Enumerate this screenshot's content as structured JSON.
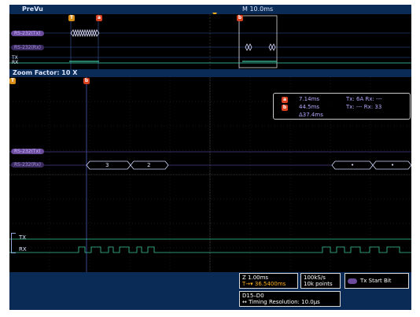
{
  "header": {
    "title": "PreVu",
    "time_label": "M 10.0ms"
  },
  "preview": {
    "channels": [
      {
        "label": "RS-232(Tx)"
      },
      {
        "label": "RS-232(Rx)"
      },
      {
        "label": "RX"
      }
    ],
    "digital_labels": [
      "TX",
      "RX"
    ],
    "marker_t": "T",
    "marker_a": "a",
    "marker_b": "b"
  },
  "zoom": {
    "label": "Zoom Factor: 10 X"
  },
  "main": {
    "marker_t": "T",
    "marker_b": "b",
    "channels": [
      {
        "label": "RS-232(Tx)"
      },
      {
        "label": "RS-232(Rx)"
      }
    ],
    "packets": [
      {
        "text": "3"
      },
      {
        "text": "2"
      },
      {
        "text": "•"
      },
      {
        "text": "•"
      }
    ],
    "digital_labels": [
      "TX",
      "RX"
    ],
    "readout": {
      "a_time": "7.14ms",
      "a_values": "Tx: 6A  Rx: ---",
      "b_time": "44.5ms",
      "b_values": "Tx: ---  Rx: 33",
      "delta": "Δ37.4ms"
    }
  },
  "status": {
    "timebase": "Z 1.00ms",
    "trigger_pos": "36.5400ms",
    "sample_rate": "100kS/s",
    "points": "10k points",
    "trigger_label": "Tx Start Bit",
    "bus": "D15–D0",
    "timing_resolution": "Timing Resolution: 10.0µs"
  },
  "colors": {
    "background": "#0a2b55",
    "screen": "#000000",
    "bus": "#6a4b9c",
    "digital": "#3cc8a0",
    "accent_orange": "#ffb020",
    "marker_red": "#d8401e"
  }
}
